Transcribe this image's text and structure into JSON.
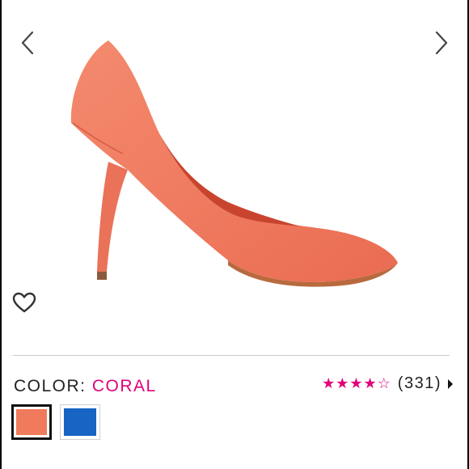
{
  "product": {
    "color_label": "COLOR:",
    "color_value": "CORAL",
    "image_icon": "coral-pointed-pump-shoe"
  },
  "navigation": {
    "prev_icon": "chevron-left-icon",
    "next_icon": "chevron-right-icon"
  },
  "rating": {
    "stars_filled": 4,
    "stars_total": 5,
    "count_text": "(331)",
    "accent_color": "#e0007a"
  },
  "swatches": [
    {
      "name": "coral",
      "color": "#f07a5c",
      "selected": true
    },
    {
      "name": "blue",
      "color": "#1764c4",
      "selected": false
    }
  ],
  "colors": {
    "accent": "#e0007a",
    "text": "#222222",
    "divider": "#c9c9c9"
  }
}
